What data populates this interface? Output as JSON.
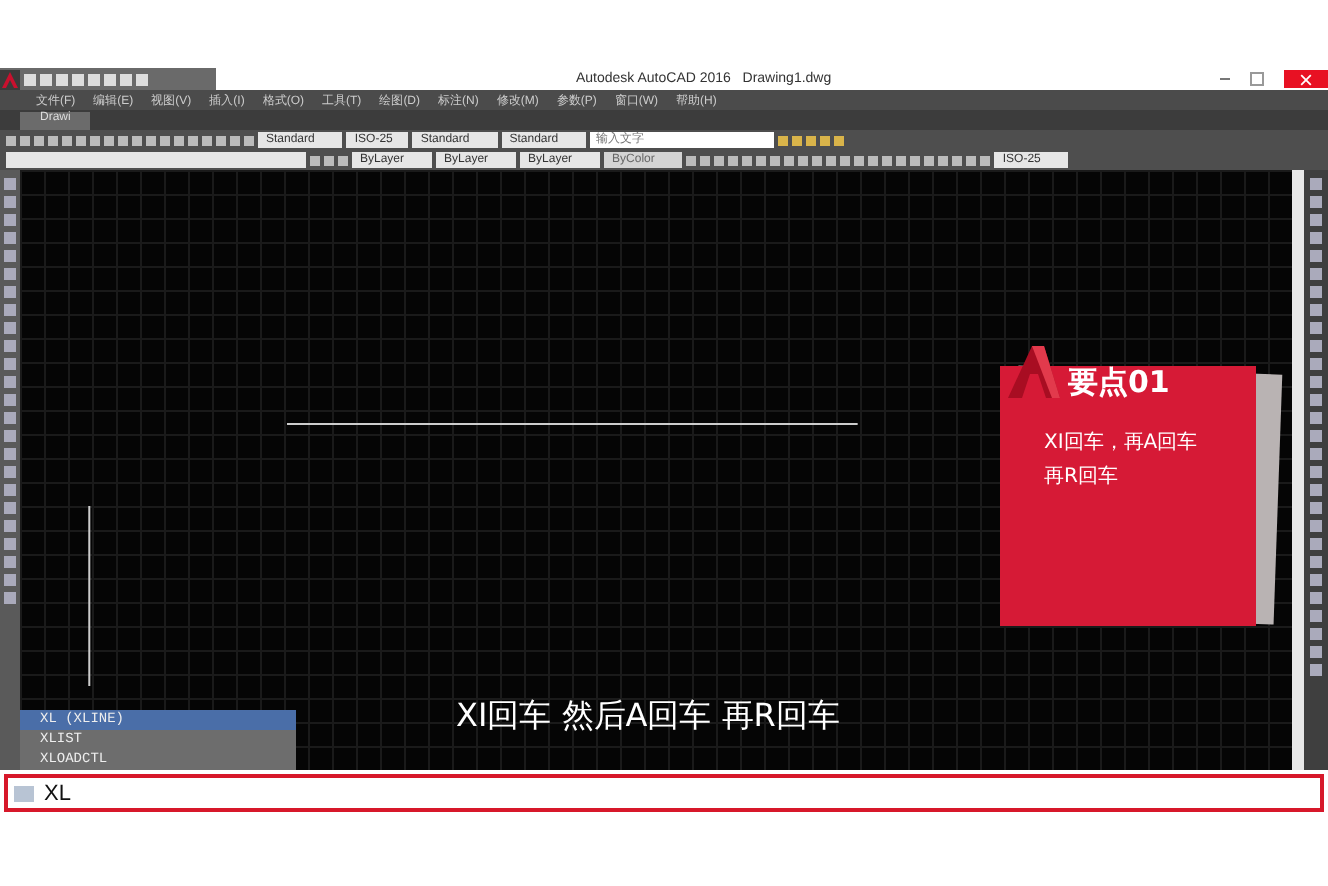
{
  "title_bar": {
    "app_title": "Autodesk AutoCAD 2016",
    "file_name": "Drawing1.dwg"
  },
  "menu_bar": [
    "文件(F)",
    "编辑(E)",
    "视图(V)",
    "插入(I)",
    "格式(O)",
    "工具(T)",
    "绘图(D)",
    "标注(N)",
    "修改(M)",
    "参数(P)",
    "窗口(W)",
    "帮助(H)"
  ],
  "document_tabs": [
    {
      "label": "Drawi",
      "selected": true
    }
  ],
  "styles_toolbar": {
    "text_style": "Standard",
    "dim_style": "ISO-25",
    "table_style": "Standard",
    "multileader_style": "Standard",
    "search": {
      "placeholder": "输入文字"
    }
  },
  "layers_toolbar": {
    "color_setting": "ByLayer",
    "linetype": "ByLayer",
    "lineweight": "ByLayer",
    "plot_style": "ByColor",
    "plot_style_disabled": true,
    "dim_style": "ISO-25"
  },
  "callout": {
    "title": "要点01",
    "lines": [
      "XI回车，再A回车",
      "再R回车"
    ]
  },
  "subtitle": "XI回车 然后A回车 再R回车",
  "autocomplete": [
    {
      "label": "XL (XLINE)",
      "selected": true
    },
    {
      "label": "XLIST",
      "selected": false
    },
    {
      "label": "XLOADCTL",
      "selected": false
    }
  ],
  "command_line": {
    "value": "XL"
  }
}
